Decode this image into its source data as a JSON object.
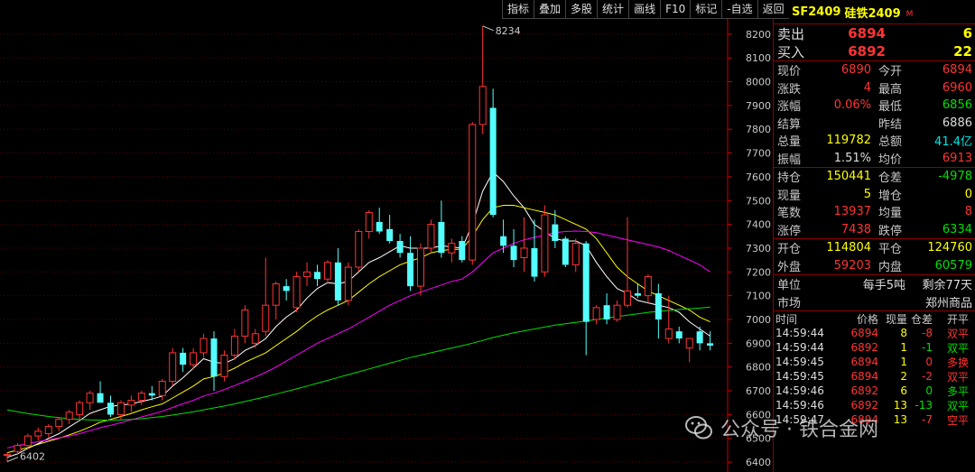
{
  "toolbar": [
    "指标",
    "叠加",
    "多股",
    "统计",
    "画线",
    "F10",
    "标记",
    "-自选",
    "返回"
  ],
  "chart_data": {
    "type": "candlestick",
    "y_ticks": [
      8200,
      8100,
      8000,
      7900,
      7800,
      7700,
      7600,
      7500,
      7400,
      7300,
      7200,
      7100,
      7000,
      6900,
      6800,
      6700,
      6600,
      6500,
      6400
    ],
    "ylim": [
      6370,
      8260
    ],
    "annotations": {
      "max_label": "8234",
      "min_label": "6402"
    },
    "candles": [
      [
        6430,
        6440,
        6402,
        6432
      ],
      [
        6445,
        6480,
        6430,
        6470
      ],
      [
        6470,
        6520,
        6455,
        6510
      ],
      [
        6510,
        6545,
        6490,
        6530
      ],
      [
        6520,
        6560,
        6505,
        6550
      ],
      [
        6550,
        6590,
        6530,
        6580
      ],
      [
        6580,
        6620,
        6560,
        6610
      ],
      [
        6600,
        6660,
        6580,
        6650
      ],
      [
        6650,
        6700,
        6620,
        6690
      ],
      [
        6690,
        6740,
        6660,
        6650
      ],
      [
        6650,
        6680,
        6590,
        6600
      ],
      [
        6600,
        6660,
        6580,
        6650
      ],
      [
        6640,
        6680,
        6610,
        6660
      ],
      [
        6660,
        6700,
        6640,
        6690
      ],
      [
        6690,
        6720,
        6660,
        6680
      ],
      [
        6680,
        6750,
        6660,
        6740
      ],
      [
        6740,
        6880,
        6720,
        6860
      ],
      [
        6860,
        6880,
        6780,
        6810
      ],
      [
        6810,
        6880,
        6790,
        6860
      ],
      [
        6860,
        6940,
        6840,
        6920
      ],
      [
        6920,
        6950,
        6700,
        6760
      ],
      [
        6760,
        6870,
        6740,
        6850
      ],
      [
        6850,
        6960,
        6830,
        6930
      ],
      [
        6930,
        7060,
        6900,
        7040
      ],
      [
        6900,
        6960,
        6880,
        6940
      ],
      [
        6950,
        7260,
        6930,
        7060
      ],
      [
        7060,
        7160,
        7000,
        7150
      ],
      [
        7140,
        7170,
        7080,
        7120
      ],
      [
        7050,
        7200,
        7030,
        7180
      ],
      [
        7180,
        7240,
        7140,
        7200
      ],
      [
        7200,
        7230,
        7140,
        7170
      ],
      [
        7170,
        7250,
        7150,
        7240
      ],
      [
        7240,
        7300,
        7060,
        7080
      ],
      [
        7080,
        7240,
        7060,
        7220
      ],
      [
        7220,
        7380,
        7200,
        7370
      ],
      [
        7370,
        7460,
        7340,
        7450
      ],
      [
        7410,
        7470,
        7360,
        7370
      ],
      [
        7380,
        7440,
        7320,
        7330
      ],
      [
        7330,
        7360,
        7260,
        7280
      ],
      [
        7280,
        7350,
        7120,
        7140
      ],
      [
        7140,
        7320,
        7100,
        7300
      ],
      [
        7300,
        7420,
        7280,
        7400
      ],
      [
        7410,
        7500,
        7260,
        7280
      ],
      [
        7280,
        7340,
        7240,
        7320
      ],
      [
        7330,
        7350,
        7240,
        7250
      ],
      [
        7250,
        7830,
        7230,
        7820
      ],
      [
        7820,
        8234,
        7780,
        7980
      ],
      [
        7890,
        7970,
        7430,
        7440
      ],
      [
        7350,
        7420,
        7280,
        7310
      ],
      [
        7310,
        7380,
        7220,
        7250
      ],
      [
        7260,
        7430,
        7200,
        7300
      ],
      [
        7300,
        7420,
        7160,
        7180
      ],
      [
        7200,
        7480,
        7180,
        7440
      ],
      [
        7400,
        7460,
        7300,
        7330
      ],
      [
        7340,
        7350,
        7220,
        7230
      ],
      [
        7230,
        7340,
        7200,
        7320
      ],
      [
        7320,
        7330,
        6850,
        6990
      ],
      [
        7000,
        7060,
        6980,
        7050
      ],
      [
        7060,
        7110,
        6980,
        7000
      ],
      [
        7000,
        7080,
        6990,
        7060
      ],
      [
        7060,
        7430,
        7050,
        7120
      ],
      [
        7110,
        7150,
        7090,
        7100
      ],
      [
        7100,
        7190,
        7070,
        7180
      ],
      [
        7110,
        7150,
        6920,
        7000
      ],
      [
        6920,
        7100,
        6900,
        6960
      ],
      [
        6950,
        6970,
        6900,
        6920
      ],
      [
        6880,
        6900,
        6820,
        6920
      ],
      [
        6950,
        6970,
        6870,
        6900
      ],
      [
        6900,
        6950,
        6870,
        6890
      ]
    ],
    "ma": [
      {
        "color": "#ffffff",
        "values": [
          6420,
          6435,
          6458,
          6478,
          6500,
          6520,
          6548,
          6575,
          6605,
          6620,
          6635,
          6640,
          6645,
          6655,
          6665,
          6678,
          6720,
          6755,
          6795,
          6835,
          6820,
          6815,
          6835,
          6870,
          6890,
          6920,
          6970,
          7010,
          7040,
          7090,
          7130,
          7155,
          7150,
          7160,
          7200,
          7240,
          7260,
          7285,
          7310,
          7300,
          7300,
          7300,
          7310,
          7305,
          7300,
          7400,
          7540,
          7620,
          7580,
          7520,
          7470,
          7400,
          7370,
          7340,
          7330,
          7330,
          7310,
          7240,
          7180,
          7130,
          7110,
          7080,
          7070,
          7060,
          7050,
          7030,
          6990,
          6960,
          6930
        ]
      },
      {
        "color": "#ffff00",
        "values": [
          6440,
          6450,
          6462,
          6475,
          6488,
          6500,
          6515,
          6530,
          6548,
          6568,
          6580,
          6592,
          6605,
          6620,
          6633,
          6645,
          6670,
          6695,
          6720,
          6750,
          6760,
          6775,
          6795,
          6820,
          6840,
          6860,
          6890,
          6920,
          6950,
          6985,
          7015,
          7040,
          7060,
          7080,
          7115,
          7150,
          7180,
          7205,
          7230,
          7245,
          7260,
          7280,
          7290,
          7295,
          7295,
          7350,
          7420,
          7470,
          7480,
          7480,
          7470,
          7460,
          7450,
          7440,
          7420,
          7400,
          7380,
          7340,
          7280,
          7220,
          7180,
          7150,
          7120,
          7100,
          7080,
          7060,
          7040,
          7010,
          6990
        ]
      },
      {
        "color": "#ff00ff",
        "values": [
          6460,
          6470,
          6478,
          6486,
          6494,
          6502,
          6510,
          6520,
          6532,
          6545,
          6555,
          6566,
          6578,
          6590,
          6602,
          6614,
          6630,
          6645,
          6660,
          6678,
          6690,
          6705,
          6722,
          6740,
          6758,
          6778,
          6800,
          6825,
          6850,
          6875,
          6900,
          6920,
          6940,
          6960,
          6985,
          7010,
          7035,
          7060,
          7080,
          7100,
          7115,
          7130,
          7145,
          7160,
          7170,
          7200,
          7240,
          7280,
          7300,
          7320,
          7335,
          7345,
          7355,
          7365,
          7370,
          7372,
          7370,
          7365,
          7355,
          7345,
          7335,
          7325,
          7315,
          7305,
          7290,
          7270,
          7250,
          7230,
          7200
        ]
      },
      {
        "color": "#00e000",
        "values": [
          6620,
          6612,
          6604,
          6598,
          6592,
          6587,
          6583,
          6580,
          6578,
          6577,
          6577,
          6578,
          6580,
          6583,
          6587,
          6592,
          6598,
          6605,
          6612,
          6620,
          6628,
          6636,
          6645,
          6655,
          6665,
          6675,
          6686,
          6697,
          6708,
          6720,
          6732,
          6744,
          6756,
          6768,
          6780,
          6792,
          6804,
          6816,
          6828,
          6840,
          6850,
          6860,
          6870,
          6880,
          6890,
          6900,
          6912,
          6924,
          6934,
          6944,
          6952,
          6960,
          6968,
          6976,
          6982,
          6988,
          6994,
          7000,
          7006,
          7012,
          7018,
          7024,
          7030,
          7034,
          7038,
          7042,
          7045,
          7048,
          7052
        ]
      }
    ]
  },
  "panel": {
    "code": "SF2409",
    "name": "硅铁2409",
    "marker": "M",
    "ask": {
      "label": "卖出",
      "price": "6894",
      "vol": "6"
    },
    "bid": {
      "label": "买入",
      "price": "6892",
      "vol": "22"
    },
    "stats1": [
      {
        "l1": "现价",
        "v1": "6890",
        "c1": "red",
        "l2": "今开",
        "v2": "6894",
        "c2": "red"
      },
      {
        "l1": "涨跌",
        "v1": "4",
        "c1": "red",
        "l2": "最高",
        "v2": "6960",
        "c2": "red"
      },
      {
        "l1": "涨幅",
        "v1": "0.06%",
        "c1": "red",
        "l2": "最低",
        "v2": "6856",
        "c2": "green"
      },
      {
        "l1": "结算",
        "v1": "",
        "c1": "white",
        "l2": "昨结",
        "v2": "6886",
        "c2": "white"
      },
      {
        "l1": "总量",
        "v1": "119782",
        "c1": "yellow",
        "l2": "总额",
        "v2": "41.4亿",
        "c2": "cyan"
      },
      {
        "l1": "振幅",
        "v1": "1.51%",
        "c1": "white",
        "l2": "均价",
        "v2": "6913",
        "c2": "red"
      }
    ],
    "stats2": [
      {
        "l1": "持仓",
        "v1": "150441",
        "c1": "yellow",
        "l2": "仓差",
        "v2": "-4978",
        "c2": "green"
      },
      {
        "l1": "现量",
        "v1": "5",
        "c1": "yellow",
        "l2": "增仓",
        "v2": "0",
        "c2": "yellow"
      },
      {
        "l1": "笔数",
        "v1": "13937",
        "c1": "red",
        "l2": "均量",
        "v2": "8",
        "c2": "red"
      },
      {
        "l1": "涨停",
        "v1": "7438",
        "c1": "red",
        "l2": "跌停",
        "v2": "6334",
        "c2": "green"
      }
    ],
    "stats3": [
      {
        "l1": "开仓",
        "v1": "114804",
        "c1": "yellow",
        "l2": "平仓",
        "v2": "124760",
        "c2": "yellow"
      },
      {
        "l1": "外盘",
        "v1": "59203",
        "c1": "red",
        "l2": "内盘",
        "v2": "60579",
        "c2": "green"
      }
    ],
    "unit": {
      "label": "单位",
      "value": "每手5吨",
      "remain": "剩余77天"
    },
    "market": {
      "label": "市场",
      "value": "郑州商品"
    },
    "tick_headers": [
      "时间",
      "价格",
      "现量",
      "仓差",
      "开平"
    ],
    "ticks": [
      {
        "time": "14:59:44",
        "price": "6894",
        "vol": "8",
        "oi": "-8",
        "oic": "red",
        "type": "双平",
        "tc": "red"
      },
      {
        "time": "14:59:44",
        "price": "6892",
        "vol": "1",
        "oi": "-1",
        "oic": "green",
        "type": "双平",
        "tc": "green"
      },
      {
        "time": "14:59:45",
        "price": "6894",
        "vol": "1",
        "oi": "0",
        "oic": "red",
        "type": "多换",
        "tc": "red"
      },
      {
        "time": "14:59:45",
        "price": "6894",
        "vol": "2",
        "oi": "-2",
        "oic": "red",
        "type": "双平",
        "tc": "red"
      },
      {
        "time": "14:59:46",
        "price": "6892",
        "vol": "6",
        "oi": "0",
        "oic": "green",
        "type": "多平",
        "tc": "green"
      },
      {
        "time": "14:59:46",
        "price": "6892",
        "vol": "13",
        "oi": "-13",
        "oic": "green",
        "type": "双平",
        "tc": "green"
      },
      {
        "time": "14:59:47",
        "price": "6894",
        "vol": "13",
        "oi": "-7",
        "oic": "red",
        "type": "空平",
        "tc": "red"
      }
    ]
  },
  "watermark": "公众号 · 铁合金网"
}
